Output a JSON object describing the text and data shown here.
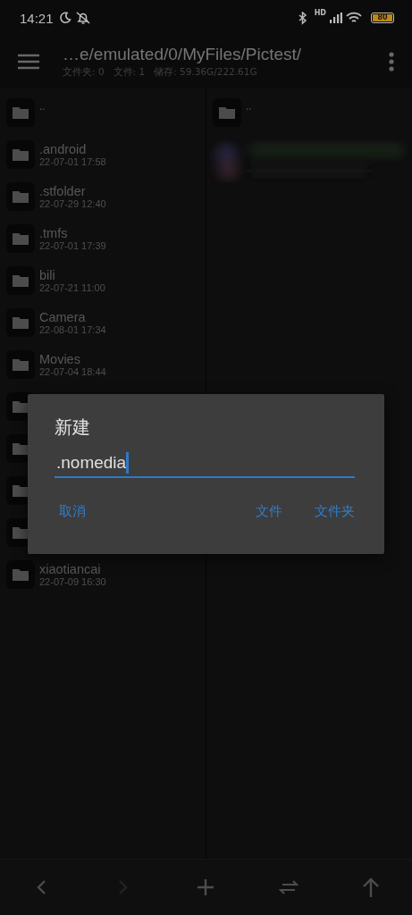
{
  "status_bar": {
    "time": "14:21",
    "signal_label": "HD",
    "battery": "80"
  },
  "toolbar": {
    "path": "…e/emulated/0/MyFiles/Pictest/",
    "summary": "文件夹: 0   文件: 1   储存: 59.36G/222.61G"
  },
  "left_pane": {
    "items": [
      {
        "kind": "parent",
        "name": ".."
      },
      {
        "kind": "folder",
        "name": ".android",
        "date": "22-07-01 17:58"
      },
      {
        "kind": "folder",
        "name": ".stfolder",
        "date": "22-07-29 12:40"
      },
      {
        "kind": "folder",
        "name": ".tmfs",
        "date": "22-07-01 17:39"
      },
      {
        "kind": "folder",
        "name": "bili",
        "date": "22-07-21 11:00"
      },
      {
        "kind": "folder",
        "name": "Camera",
        "date": "22-08-01 17:34"
      },
      {
        "kind": "folder",
        "name": "Movies",
        "date": "22-07-04 18:44"
      },
      {
        "kind": "covered"
      },
      {
        "kind": "covered"
      },
      {
        "kind": "covered"
      },
      {
        "kind": "covered"
      },
      {
        "kind": "folder",
        "name": "xiaotiancai",
        "date": "22-07-09 16:30"
      }
    ]
  },
  "right_pane": {
    "items": [
      {
        "kind": "parent",
        "name": ".."
      },
      {
        "kind": "picture"
      }
    ]
  },
  "dialog": {
    "title": "新建",
    "value": ".nomedia",
    "buttons": [
      {
        "label": "取消",
        "kind": "left"
      },
      {
        "label": "文件",
        "kind": "right"
      },
      {
        "label": "文件夹",
        "kind": "right"
      }
    ]
  },
  "bottom_nav": [
    {
      "kind": "back",
      "disabled": false
    },
    {
      "kind": "forward",
      "disabled": true
    },
    {
      "kind": "add",
      "disabled": false
    },
    {
      "kind": "swap",
      "disabled": false
    },
    {
      "kind": "up",
      "disabled": false
    }
  ]
}
